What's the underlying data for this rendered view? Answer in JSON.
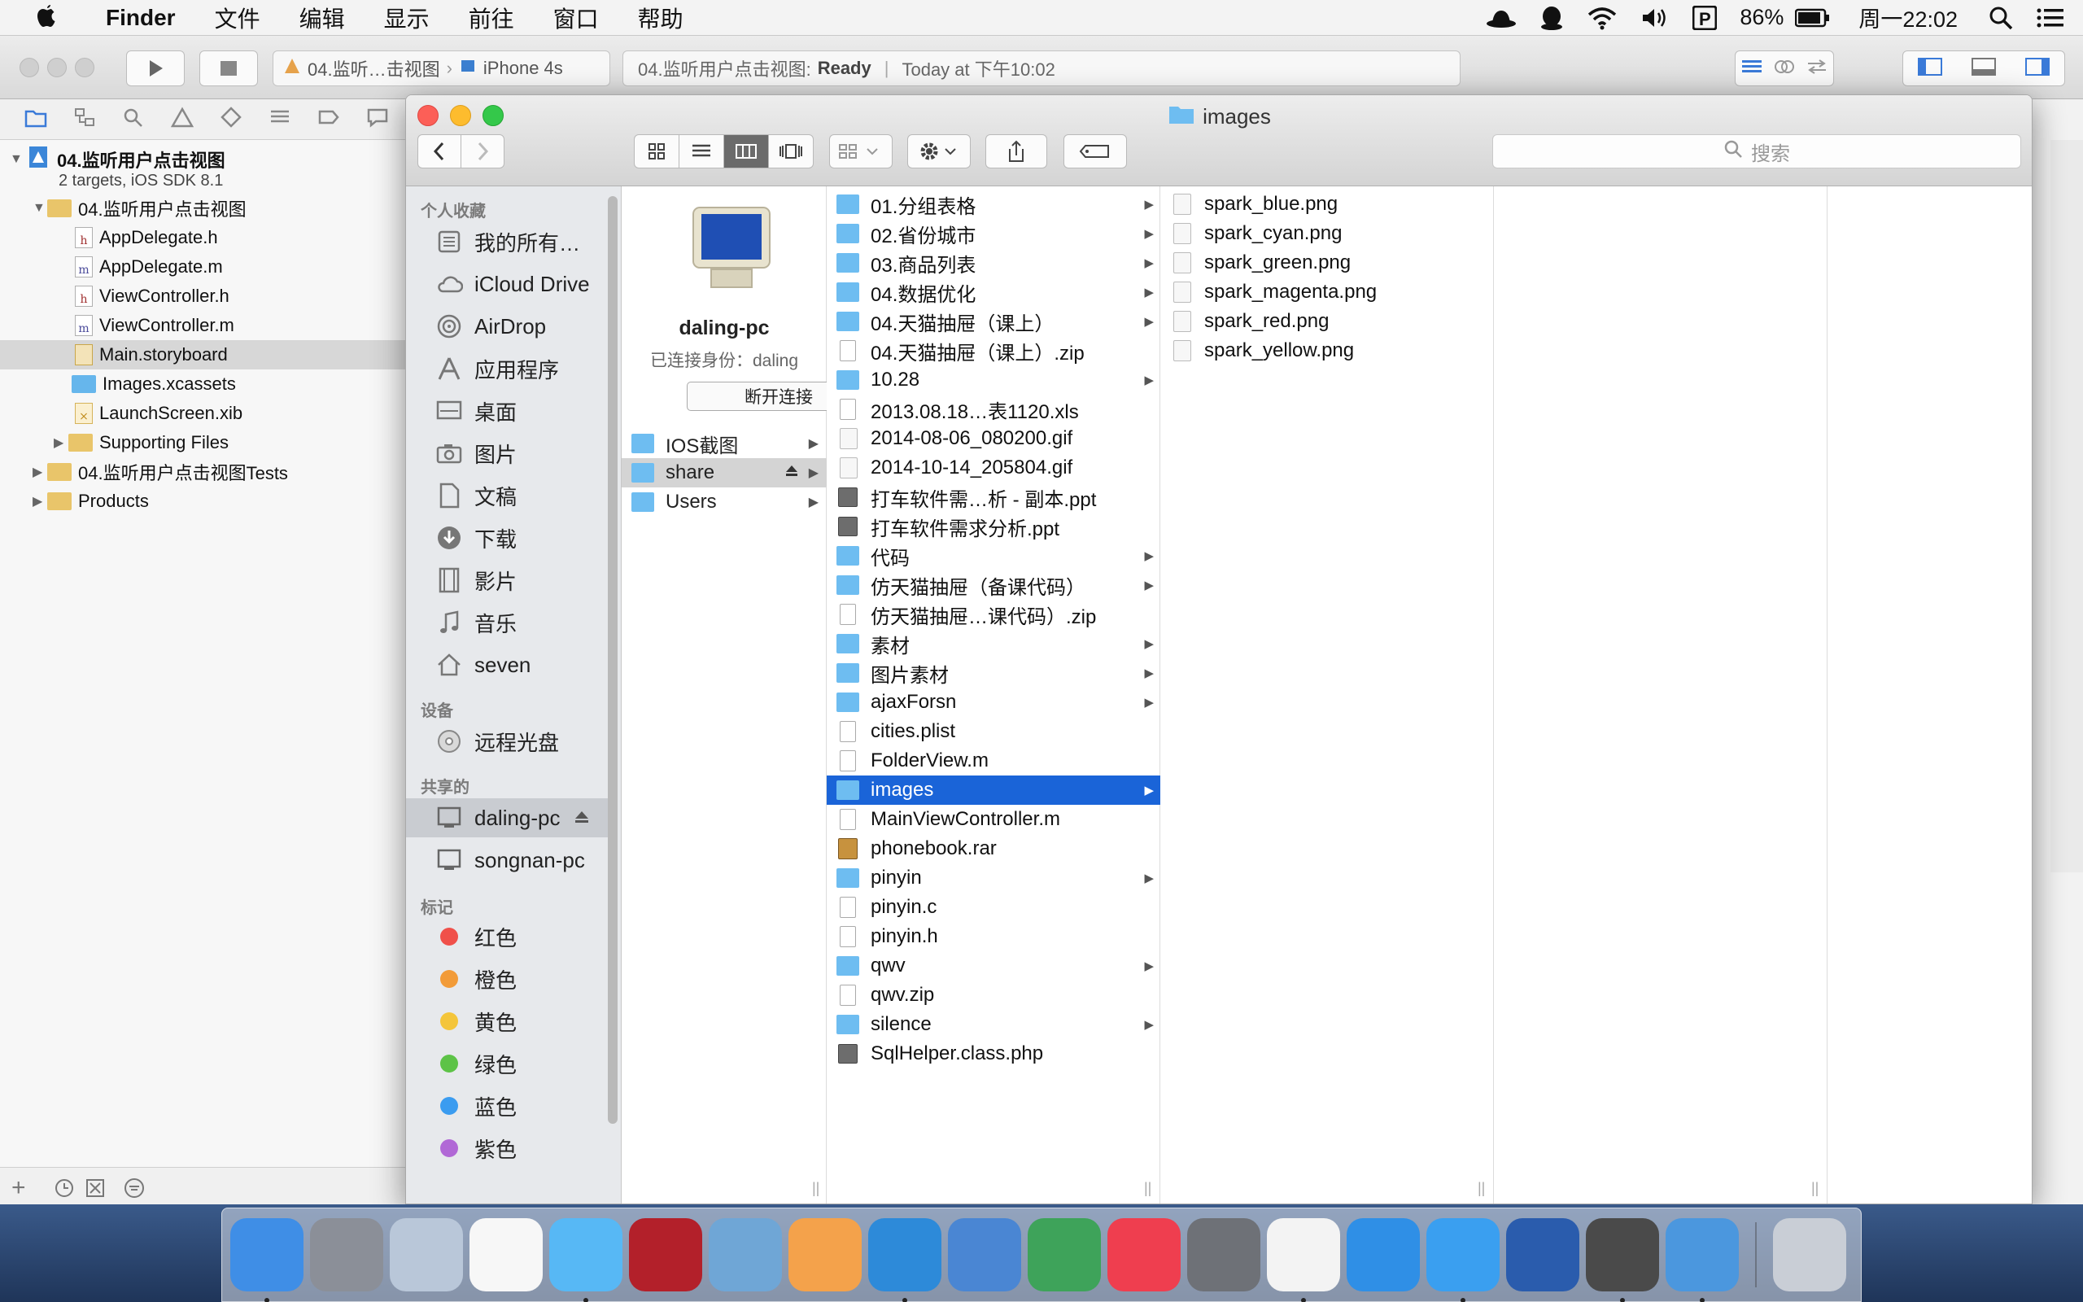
{
  "menubar": {
    "app": "Finder",
    "items": [
      "文件",
      "编辑",
      "显示",
      "前往",
      "窗口",
      "帮助"
    ],
    "battery": "86%",
    "clock": "周一22:02"
  },
  "xcode": {
    "scheme_project": "04.监听…击视图",
    "scheme_device": "iPhone 4s",
    "status_project": "04.监听用户点击视图:",
    "status_state": "Ready",
    "status_time": "Today at 下午10:02",
    "navigator": [
      {
        "label": "04.监听用户点击视图",
        "kind": "project"
      },
      {
        "label": "2 targets, iOS SDK 8.1",
        "kind": "subtitle"
      },
      {
        "label": "04.监听用户点击视图",
        "kind": "group"
      },
      {
        "label": "AppDelegate.h",
        "kind": "h"
      },
      {
        "label": "AppDelegate.m",
        "kind": "m"
      },
      {
        "label": "ViewController.h",
        "kind": "h"
      },
      {
        "label": "ViewController.m",
        "kind": "m"
      },
      {
        "label": "Main.storyboard",
        "kind": "storyboard"
      },
      {
        "label": "Images.xcassets",
        "kind": "assets"
      },
      {
        "label": "LaunchScreen.xib",
        "kind": "xib"
      },
      {
        "label": "Supporting Files",
        "kind": "group"
      },
      {
        "label": "04.监听用户点击视图Tests",
        "kind": "group"
      },
      {
        "label": "Products",
        "kind": "group"
      }
    ]
  },
  "finder": {
    "title": "images",
    "search_placeholder": "搜索",
    "sidebar": {
      "favorites_header": "个人收藏",
      "favorites": [
        "我的所有…",
        "iCloud Drive",
        "AirDrop",
        "应用程序",
        "桌面",
        "图片",
        "文稿",
        "下载",
        "影片",
        "音乐",
        "seven"
      ],
      "devices_header": "设备",
      "devices": [
        "远程光盘"
      ],
      "shared_header": "共享的",
      "shared": [
        "daling-pc",
        "songnan-pc"
      ],
      "tags_header": "标记",
      "tags": [
        {
          "label": "红色",
          "color": "#f0504a"
        },
        {
          "label": "橙色",
          "color": "#f29b38"
        },
        {
          "label": "黄色",
          "color": "#f4c53a"
        },
        {
          "label": "绿色",
          "color": "#5dc347"
        },
        {
          "label": "蓝色",
          "color": "#3b9cf0"
        },
        {
          "label": "紫色",
          "color": "#b168d6"
        }
      ]
    },
    "server": {
      "name": "daling-pc",
      "connected_as": "已连接身份：daling",
      "disconnect": "断开连接",
      "shares": [
        "IOS截图",
        "share",
        "Users"
      ]
    },
    "column2": [
      {
        "name": "01.分组表格",
        "type": "folder"
      },
      {
        "name": "02.省份城市",
        "type": "folder"
      },
      {
        "name": "03.商品列表",
        "type": "folder"
      },
      {
        "name": "04.数据优化",
        "type": "folder"
      },
      {
        "name": "04.天猫抽屉（课上）",
        "type": "folder"
      },
      {
        "name": "04.天猫抽屉（课上）.zip",
        "type": "doc"
      },
      {
        "name": "10.28",
        "type": "folder"
      },
      {
        "name": "2013.08.18…表1120.xls",
        "type": "doc"
      },
      {
        "name": "2014-08-06_080200.gif",
        "type": "img"
      },
      {
        "name": "2014-10-14_205804.gif",
        "type": "img"
      },
      {
        "name": "打车软件需…析 - 副本.ppt",
        "type": "dark"
      },
      {
        "name": "打车软件需求分析.ppt",
        "type": "dark"
      },
      {
        "name": "代码",
        "type": "folder"
      },
      {
        "name": "仿天猫抽屉（备课代码）",
        "type": "folder"
      },
      {
        "name": "仿天猫抽屉…课代码）.zip",
        "type": "doc"
      },
      {
        "name": "素材",
        "type": "folder"
      },
      {
        "name": "图片素材",
        "type": "folder"
      },
      {
        "name": "ajaxForsn",
        "type": "folder"
      },
      {
        "name": "cities.plist",
        "type": "doc"
      },
      {
        "name": "FolderView.m",
        "type": "doc"
      },
      {
        "name": "images",
        "type": "folder",
        "selected": true
      },
      {
        "name": "MainViewController.m",
        "type": "doc"
      },
      {
        "name": "phonebook.rar",
        "type": "rar"
      },
      {
        "name": "pinyin",
        "type": "folder"
      },
      {
        "name": "pinyin.c",
        "type": "doc"
      },
      {
        "name": "pinyin.h",
        "type": "doc"
      },
      {
        "name": "qwv",
        "type": "folder"
      },
      {
        "name": "qwv.zip",
        "type": "doc"
      },
      {
        "name": "silence",
        "type": "folder"
      },
      {
        "name": "SqlHelper.class.php",
        "type": "dark"
      }
    ],
    "column3": [
      "spark_blue.png",
      "spark_cyan.png",
      "spark_green.png",
      "spark_magenta.png",
      "spark_red.png",
      "spark_yellow.png"
    ]
  },
  "dock": {
    "apps": [
      {
        "name": "finder",
        "color": "#3f8ee6",
        "running": true
      },
      {
        "name": "launchpad",
        "color": "#8b8f98",
        "running": false
      },
      {
        "name": "mail",
        "color": "#b9c7d9",
        "running": false
      },
      {
        "name": "calendar",
        "color": "#f7f7f7",
        "running": false
      },
      {
        "name": "messages",
        "color": "#57b8f5",
        "running": true
      },
      {
        "name": "photo-booth",
        "color": "#b3202a",
        "running": false
      },
      {
        "name": "iphoto",
        "color": "#6fa6d6",
        "running": false
      },
      {
        "name": "pages",
        "color": "#f4a24b",
        "running": false
      },
      {
        "name": "xcode",
        "color": "#2d8ad9",
        "running": true
      },
      {
        "name": "keynote",
        "color": "#4a86d3",
        "running": false
      },
      {
        "name": "numbers",
        "color": "#3ea35a",
        "running": false
      },
      {
        "name": "itunes",
        "color": "#ef3e4f",
        "running": false
      },
      {
        "name": "system-preferences",
        "color": "#6e7177",
        "running": false
      },
      {
        "name": "qq",
        "color": "#f3f3f3",
        "running": true
      },
      {
        "name": "app-store",
        "color": "#2f8fe6",
        "running": false
      },
      {
        "name": "safari",
        "color": "#3a9ff0",
        "running": true
      },
      {
        "name": "word",
        "color": "#2a5cad",
        "running": false
      },
      {
        "name": "sublime-text",
        "color": "#4a4a4a",
        "running": true
      },
      {
        "name": "ios-simulator",
        "color": "#4b97de",
        "running": true
      },
      {
        "name": "trash",
        "color": "#c9ced6",
        "running": false
      }
    ]
  }
}
